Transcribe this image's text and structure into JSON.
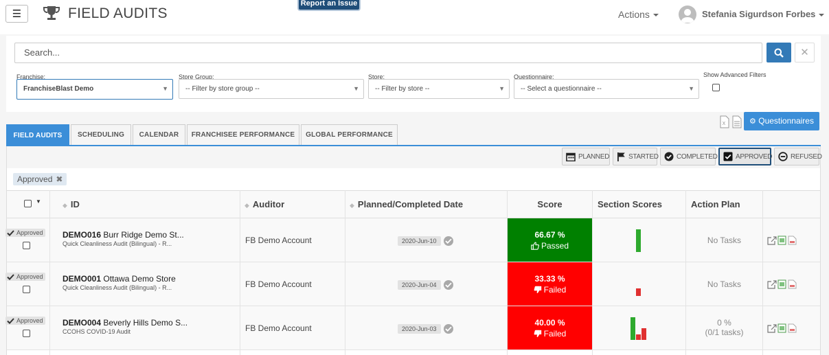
{
  "header": {
    "title": "FIELD AUDITS",
    "report_issue": "Report an Issue",
    "actions_label": "Actions",
    "user_name": "Stefania Sigurdson Forbes"
  },
  "search": {
    "placeholder": "Search..."
  },
  "filters": {
    "franchise": {
      "label": "Franchise:",
      "value": "FranchiseBlast Demo"
    },
    "store_group": {
      "label": "Store Group:",
      "value": "-- Filter by store group --"
    },
    "store": {
      "label": "Store:",
      "value": "-- Filter by store --"
    },
    "questionnaire": {
      "label": "Questionnaire:",
      "value": "-- Select a questionnaire --"
    },
    "advanced": {
      "label": "Show Advanced Filters",
      "checked": false
    }
  },
  "questionnaires_button": "Questionnaires",
  "tabs": [
    {
      "label": "FIELD AUDITS",
      "active": true
    },
    {
      "label": "SCHEDULING"
    },
    {
      "label": "CALENDAR"
    },
    {
      "label": "FRANCHISEE PERFORMANCE"
    },
    {
      "label": "GLOBAL PERFORMANCE"
    }
  ],
  "status_filters": [
    {
      "label": "PLANNED",
      "icon": "calendar-icon"
    },
    {
      "label": "STARTED",
      "icon": "flag-icon"
    },
    {
      "label": "COMPLETED",
      "icon": "check-circle-icon"
    },
    {
      "label": "APPROVED",
      "icon": "checkbox-icon",
      "selected": true
    },
    {
      "label": "REFUSED",
      "icon": "minus-circle-icon"
    }
  ],
  "active_filter_chip": "Approved",
  "table": {
    "columns": [
      "ID",
      "Auditor",
      "Planned/Completed Date",
      "Score",
      "Section Scores",
      "Action Plan"
    ],
    "rows": [
      {
        "status": "Approved",
        "id_code": "DEMO016",
        "store": "Burr Ridge Demo St...",
        "questionnaire": "Quick Cleanliness Audit (Bilingual) - R...",
        "auditor": "FB Demo Account",
        "date": "2020-Jun-10",
        "score": "66.67 %",
        "result": "Passed",
        "score_color": "#008000",
        "section_scores": [
          {
            "value": 1.0,
            "color": "#2eaa2e"
          }
        ],
        "action_plan": "No Tasks",
        "action_plan_sub": ""
      },
      {
        "status": "Approved",
        "id_code": "DEMO001",
        "store": "Ottawa Demo Store",
        "questionnaire": "Quick Cleanliness Audit (Bilingual) - R...",
        "auditor": "FB Demo Account",
        "date": "2020-Jun-04",
        "score": "33.33 %",
        "result": "Failed",
        "score_color": "#ff0000",
        "section_scores": [
          {
            "value": 0.33,
            "color": "#e03030"
          }
        ],
        "action_plan": "No Tasks",
        "action_plan_sub": ""
      },
      {
        "status": "Approved",
        "id_code": "DEMO004",
        "store": "Beverly Hills Demo S...",
        "questionnaire": "CCOHS COVID-19 Audit",
        "auditor": "FB Demo Account",
        "date": "2020-Jun-03",
        "score": "40.00 %",
        "result": "Failed",
        "score_color": "#ff0000",
        "section_scores": [
          {
            "value": 1.0,
            "color": "#2eaa2e"
          },
          {
            "value": 0.25,
            "color": "#e03030"
          },
          {
            "value": 0.5,
            "color": "#e03030"
          }
        ],
        "action_plan": "0 %",
        "action_plan_sub": "(0/1 tasks)"
      }
    ]
  }
}
